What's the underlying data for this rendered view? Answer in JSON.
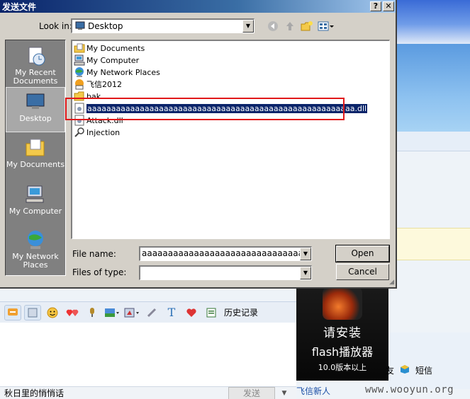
{
  "dialog": {
    "title": "发送文件",
    "help_label": "?",
    "close_label": "✕",
    "look_in_label": "Look in:",
    "look_in_value": "Desktop",
    "file_name_label": "File name:",
    "file_name_value": "aaaaaaaaaaaaaaaaaaaaaaaaaaaaaaaaaaaaaaaaaaaaaaaaaaaaaaaaaaaaaaaaaaaaa",
    "files_of_type_label": "Files of type:",
    "files_of_type_value": "",
    "open_label": "Open",
    "cancel_label": "Cancel"
  },
  "places": [
    {
      "label": "My Recent Documents",
      "icon": "recent-documents-icon"
    },
    {
      "label": "Desktop",
      "icon": "desktop-icon"
    },
    {
      "label": "My Documents",
      "icon": "my-documents-icon"
    },
    {
      "label": "My Computer",
      "icon": "my-computer-icon"
    },
    {
      "label": "My Network Places",
      "icon": "network-places-icon"
    }
  ],
  "files": [
    {
      "name": "My Documents",
      "icon": "my-documents-icon"
    },
    {
      "name": "My Computer",
      "icon": "my-computer-icon"
    },
    {
      "name": "My Network Places",
      "icon": "network-places-icon"
    },
    {
      "name": "飞信2012",
      "icon": "fetion-icon"
    },
    {
      "name": "bak",
      "icon": "folder-icon"
    },
    {
      "name": "aaaaaaaaaaaaaaaaaaaaaaaaaaaaaaaaaaaaaaaaaaaaaaaaaaaaaaaa.dll",
      "icon": "dll-file-icon"
    },
    {
      "name": "Attack.dll",
      "icon": "dll-file-icon"
    },
    {
      "name": "Injection",
      "icon": "shortcut-icon"
    }
  ],
  "chat": {
    "history_label": "历史记录",
    "footer_hint": "秋日里的悄悄话",
    "send_label": "发送"
  },
  "ad": {
    "line1": "请安装",
    "line2": "flash播放器",
    "line3": "10.0版本以上"
  },
  "side": {
    "fetion_new": "飞信新人",
    "sms_label": "短信",
    "partial_char": "友"
  },
  "watermark": "www.wooyun.org",
  "colors": {
    "title_bar": "#0a246a",
    "selection": "#0a246a",
    "highlight_box": "#e0181a"
  }
}
